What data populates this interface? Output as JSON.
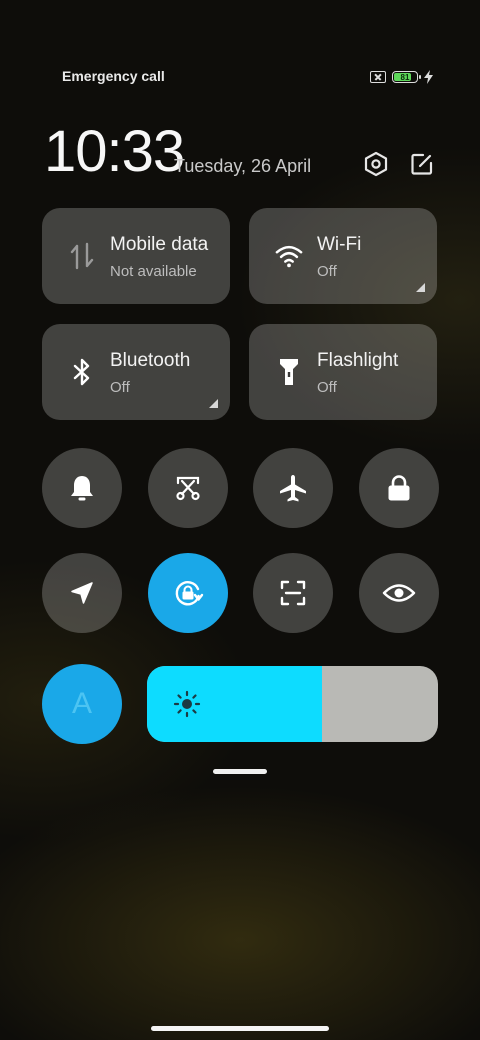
{
  "status": {
    "carrier_text": "Emergency call",
    "battery_level": 81,
    "battery_text": "81"
  },
  "header": {
    "time": "10:33",
    "date": "Tuesday, 26 April",
    "settings_icon": "settings-hexagon-icon",
    "edit_icon": "edit-icon"
  },
  "tiles": [
    {
      "title": "Mobile data",
      "subtitle": "Not available",
      "icon": "mobile-data-icon"
    },
    {
      "title": "Wi-Fi",
      "subtitle": "Off",
      "icon": "wifi-icon"
    },
    {
      "title": "Bluetooth",
      "subtitle": "Off",
      "icon": "bluetooth-icon"
    },
    {
      "title": "Flashlight",
      "subtitle": "Off",
      "icon": "flashlight-icon"
    }
  ],
  "toggles": [
    {
      "icon": "bell-icon",
      "active": false
    },
    {
      "icon": "screenshot-scissors-icon",
      "active": false
    },
    {
      "icon": "airplane-icon",
      "active": false
    },
    {
      "icon": "lock-icon",
      "active": false
    },
    {
      "icon": "location-icon",
      "active": false
    },
    {
      "icon": "rotation-lock-icon",
      "active": true
    },
    {
      "icon": "scan-icon",
      "active": false
    },
    {
      "icon": "eye-icon",
      "active": false
    }
  ],
  "auto_brightness": {
    "label": "A",
    "active": true
  },
  "brightness": {
    "level": 0.6,
    "icon": "sun-icon"
  },
  "colors": {
    "accent": "#1aa8e8",
    "slider": "#0ddcff",
    "battery": "#5ed85a"
  }
}
